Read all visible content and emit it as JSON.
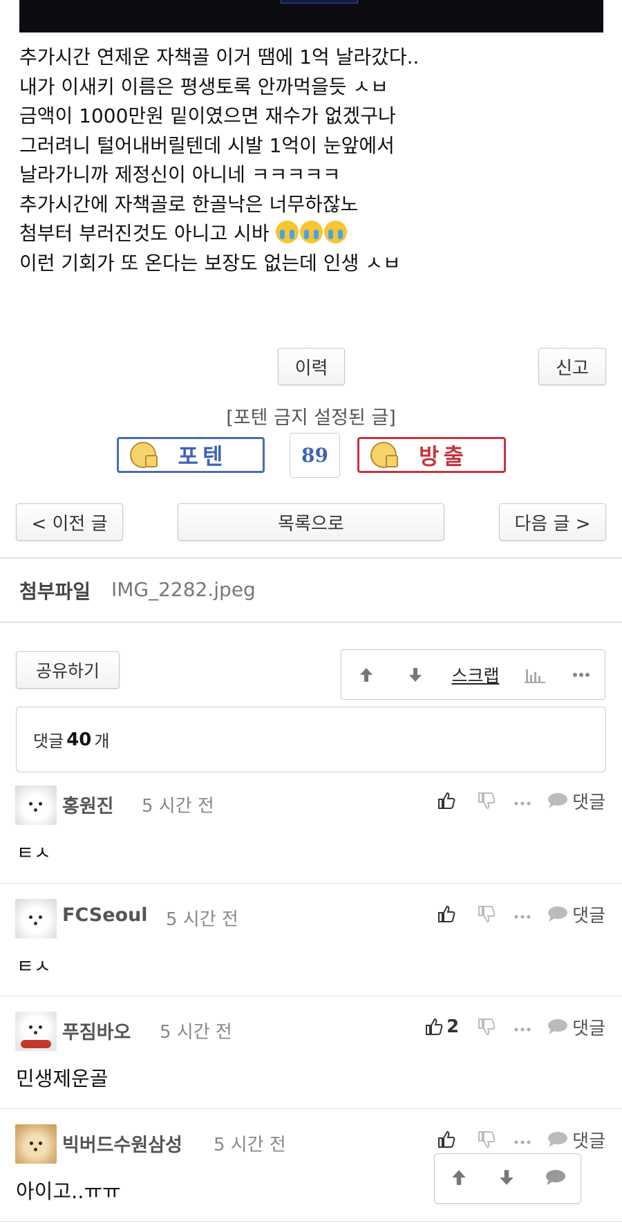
{
  "post": {
    "lines": [
      "추가시간 연제운 자책골 이거 땜에 1억 날라갔다..",
      "내가 이새키 이름은 평생토록 안까먹을듯 ㅅㅂ",
      "금액이 1000만원 밑이였으면 재수가 없겠구나",
      "그러려니 털어내버릴텐데 시발 1억이 눈앞에서",
      "날라가니까 제정신이 아니네 ㅋㅋㅋㅋㅋ",
      "추가시간에 자책골로 한골낙은 너무하잖노",
      "첨부터 부러진것도 아니고 시바",
      "이런 기회가 또 온다는 보장도 없는데 인생 ㅅㅂ"
    ],
    "emoji_icon": "crying-face-icon"
  },
  "buttons": {
    "history": "이력",
    "report": "신고",
    "prev": "< 이전 글",
    "list": "목록으로",
    "next": "다음 글 >",
    "share": "공유하기"
  },
  "vote": {
    "notice": "[포텐 금지 설정된 글]",
    "up_label": "포텐",
    "down_label": "방출",
    "count": "89",
    "colors": {
      "up": "#3f63b6",
      "down": "#c8343e"
    }
  },
  "attachment": {
    "label": "첨부파일",
    "filename": "IMG_2282.jpeg"
  },
  "toolbar": {
    "scrap_label": "스크랩",
    "icons": [
      "arrow-up-icon",
      "arrow-down-icon",
      "bar-chart-icon",
      "more-icon"
    ]
  },
  "comments_summary": {
    "prefix": "댓글",
    "count": "40",
    "suffix": "개"
  },
  "comments": [
    {
      "author": "홍원진",
      "time": "5 시간 전",
      "text": "ㅌㅅ",
      "likes": "",
      "reply_label": "댓글"
    },
    {
      "author": "FCSeoul",
      "time": "5 시간 전",
      "text": "ㅌㅅ",
      "likes": "",
      "reply_label": "댓글"
    },
    {
      "author": "푸짐바오",
      "time": "5 시간 전",
      "text": "민생제운골",
      "likes": "2",
      "reply_label": "댓글"
    },
    {
      "author": "빅버드수원삼성",
      "time": "5 시간 전",
      "text": "아이고..ㅠㅠ",
      "likes": "",
      "reply_label": "댓글"
    }
  ]
}
